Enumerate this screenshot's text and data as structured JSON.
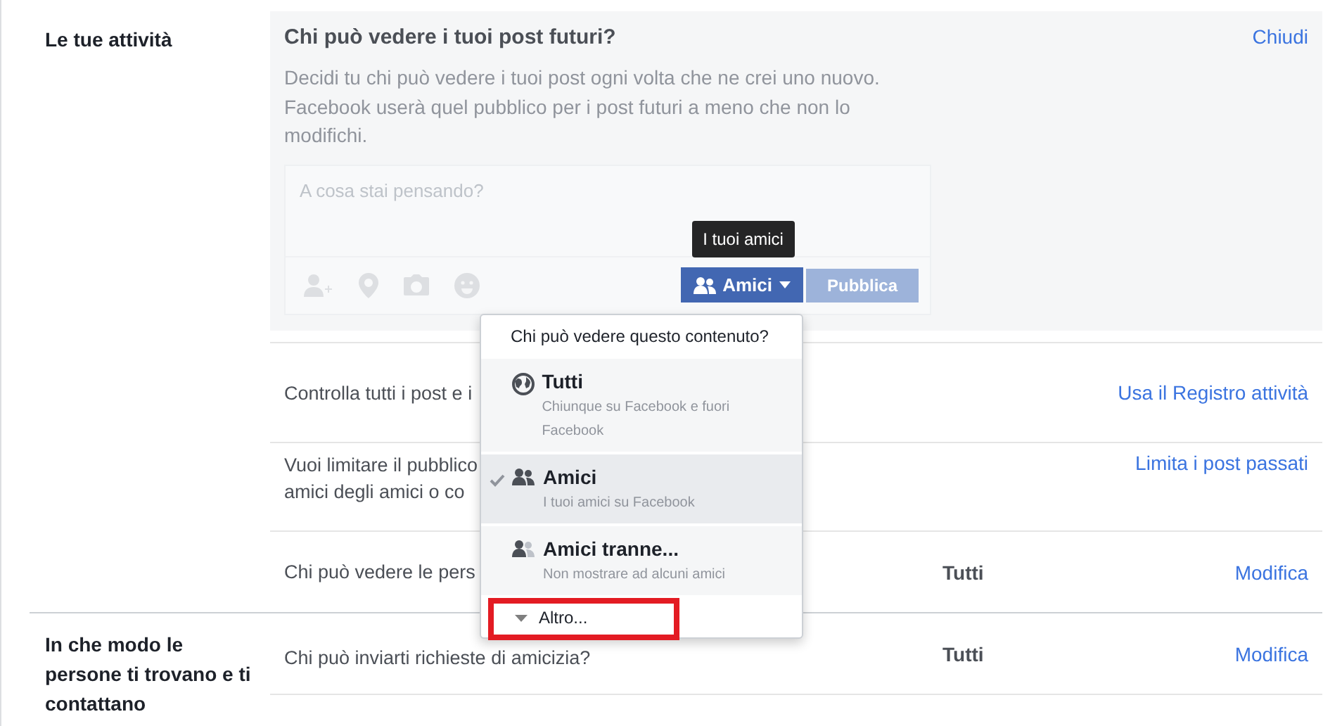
{
  "sections": [
    {
      "label": "Le tue attività",
      "panel": {
        "title": "Chi può vedere i tuoi post futuri?",
        "close": "Chiudi",
        "description": "Decidi tu chi può vedere i tuoi post ogni volta che ne crei uno nuovo. Facebook userà quel pubblico per i post futuri a meno che non lo modifichi.",
        "composer": {
          "placeholder": "A cosa stai pensando?",
          "tools": [
            {
              "kind": "tag"
            },
            {
              "kind": "location"
            },
            {
              "kind": "photo"
            },
            {
              "kind": "feeling"
            }
          ],
          "audience_button": "Amici",
          "publish_button": {
            "label": "Pubblica",
            "disabled": true
          },
          "tooltip": "I tuoi amici"
        }
      },
      "rows": [
        {
          "lines": [
            "Controlla tutti i post e i"
          ],
          "value": "",
          "action": "Usa il Registro attività"
        },
        {
          "lines": [
            "Vuoi limitare il pubblico",
            "amici degli amici o co"
          ],
          "value": "",
          "action": "Limita i post passati"
        },
        {
          "lines": [
            "Chi può vedere le pers"
          ],
          "value": "Tutti",
          "action": "Modifica"
        }
      ]
    },
    {
      "label": "In che modo le persone ti trovano e ti contattano",
      "rows": [
        {
          "lines": [
            "Chi può inviarti richieste di amicizia?"
          ],
          "value": "Tutti",
          "action": "Modifica"
        }
      ]
    }
  ],
  "audience_menu": {
    "header": "Chi può vedere questo contenuto?",
    "options": [
      {
        "kind": "globe",
        "title": "Tutti",
        "subtitle": "Chiunque su Facebook e fuori Facebook",
        "selected": false
      },
      {
        "kind": "friends",
        "title": "Amici",
        "subtitle": "I tuoi amici su Facebook",
        "selected": true
      },
      {
        "kind": "friends-except",
        "title": "Amici tranne...",
        "subtitle": "Non mostrare ad alcuni amici",
        "selected": false
      }
    ],
    "more": {
      "label": "Altro...",
      "highlighted": true
    }
  }
}
